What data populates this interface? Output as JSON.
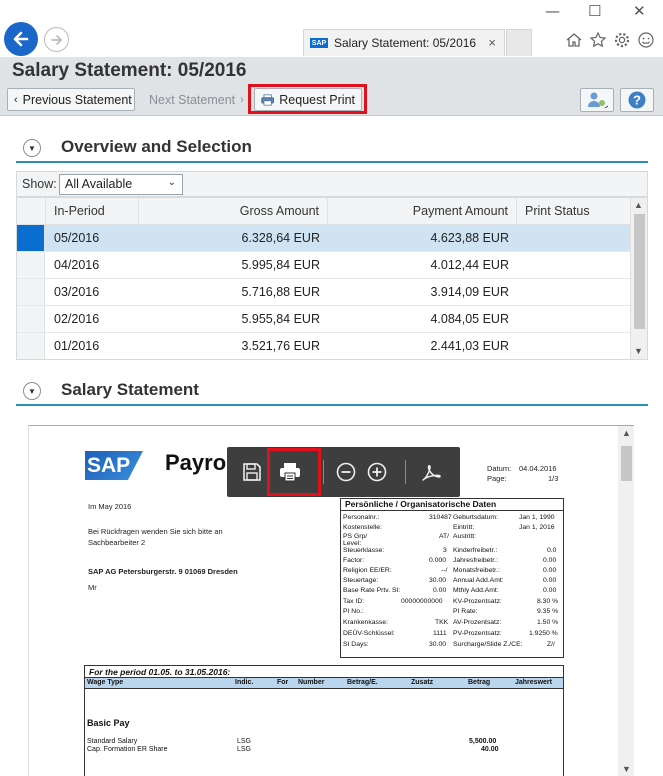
{
  "browser": {
    "tab_title": "Salary Statement: 05/2016",
    "tab_icon": "SAP",
    "close_tab": "×",
    "win_min": "—",
    "win_max": "☐",
    "win_close": "✕"
  },
  "header": {
    "title": "Salary Statement: 05/2016",
    "prev_label": "Previous Statement",
    "next_label": "Next Statement",
    "print_label": "Request Print"
  },
  "overview": {
    "title": "Overview and Selection",
    "show_label": "Show:",
    "show_value": "All Available",
    "columns": [
      "In-Period",
      "Gross Amount",
      "Payment Amount",
      "Print Status"
    ],
    "rows": [
      {
        "period": "05/2016",
        "gross": "6.328,64 EUR",
        "payment": "4.623,88 EUR",
        "status": ""
      },
      {
        "period": "04/2016",
        "gross": "5.995,84 EUR",
        "payment": "4.012,44 EUR",
        "status": ""
      },
      {
        "period": "03/2016",
        "gross": "5.716,88 EUR",
        "payment": "3.914,09 EUR",
        "status": ""
      },
      {
        "period": "02/2016",
        "gross": "5.955,84 EUR",
        "payment": "4.084,05 EUR",
        "status": ""
      },
      {
        "period": "01/2016",
        "gross": "3.521,76 EUR",
        "payment": "2.441,03 EUR",
        "status": ""
      }
    ]
  },
  "statement": {
    "title": "Salary Statement",
    "doc": {
      "logo": "SAP",
      "heading": "Payro",
      "date_label": "Datum:",
      "date_value": "04.04.2016",
      "page_label": "Page:",
      "page_value": "1/3",
      "month_line": "Im May 2016",
      "contact_line1": "Bei Rückfragen wenden Sie sich bitte an",
      "contact_line2": "Sachbearbeiter 2",
      "address": "SAP AG Petersburgerstr. 9  01069 Dresden",
      "salutation": "Mr",
      "personal_heading": "Persönliche / Organisatorische Daten",
      "personal_rows": [
        {
          "l1": "Personalnr.:",
          "v1": "310487",
          "l2": "Geburtsdatum:",
          "v2": "Jan 1, 1990"
        },
        {
          "l1": "Kostenstelle:",
          "v1": "",
          "l2": "Eintritt:",
          "v2": "Jan 1, 2016"
        },
        {
          "l1": "PS Grp/",
          "v1": "AT/",
          "l2": "Austritt:",
          "v2": ""
        },
        {
          "l1": "Level:",
          "v1": "",
          "l2": "",
          "v2": ""
        },
        {
          "l1": "Steuerklasse:",
          "v1": "3",
          "l2": "Kinderfreibetr.:",
          "v2": "0.0"
        },
        {
          "l1": "Factor:",
          "v1": "0.000",
          "l2": "Jahresfreibetr.:",
          "v2": "0.00"
        },
        {
          "l1": "Religion EE/ER:",
          "v1": "--/",
          "l2": "Monatsfreibetr.:",
          "v2": "0.00"
        },
        {
          "l1": "Steuertage:",
          "v1": "30.00",
          "l2": "Annual Add.Amt:",
          "v2": "0.00"
        },
        {
          "l1": "Base Rate Prtv. SI:",
          "v1": "0.00",
          "l2": "Mthly Add.Amt:",
          "v2": "0.00"
        },
        {
          "l1": "Tax ID:",
          "v1": "00000000000",
          "l2": "KV-Prozentsatz:",
          "v2": "8.30 %"
        },
        {
          "l1": "PI No.:",
          "v1": "",
          "l2": "PI Rate:",
          "v2": "9.35 %"
        },
        {
          "l1": "Krankenkasse:",
          "v1": "TKK",
          "l2": "AV-Prozentsatz:",
          "v2": "1.50 %"
        },
        {
          "l1": "DEÜV-Schlüssel:",
          "v1": "1111",
          "l2": "PV-Prozentsatz:",
          "v2": "1.9250 %"
        },
        {
          "l1": "SI Days:",
          "v1": "30.00",
          "l2": "Surcharge/Slide Z./CE:",
          "v2": "Z//"
        }
      ],
      "period_title": "For the period 01.05. to 31.05.2016:",
      "period_columns": [
        "Wage Type",
        "Indic.",
        "For",
        "Number",
        "Betrag/E.",
        "Zusatz",
        "Betrag",
        "Jahreswert"
      ],
      "basic_pay": "Basic Pay",
      "wage_rows": [
        {
          "name": "Standard Salary",
          "ind": "LSG",
          "amount": "5,500.00"
        },
        {
          "name": "Cap. Formation ER Share",
          "ind": "LSG",
          "amount": "40.00"
        }
      ]
    }
  }
}
